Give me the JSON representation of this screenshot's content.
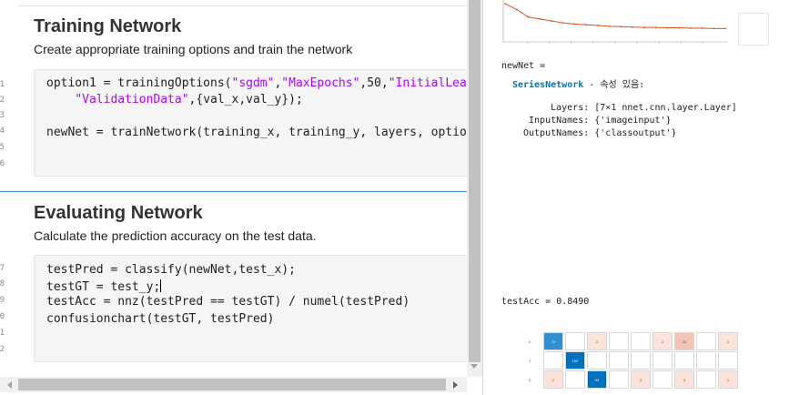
{
  "gutter": {
    "lines": [
      "1",
      "2",
      "3",
      "4",
      "5",
      "6",
      "7",
      "8",
      "9",
      "0",
      "1",
      "2"
    ]
  },
  "training_section": {
    "title": "Training Network",
    "description": "Create appropriate training options and train the network",
    "code": {
      "line1_a": "option1 = trainingOptions(",
      "line1_s1": "\"sgdm\"",
      "line1_b": ",",
      "line1_s2": "\"MaxEpochs\"",
      "line1_c": ",50,",
      "line1_s3": "\"InitialLear",
      "line2_pad": "    ",
      "line2_s1": "\"ValidationData\"",
      "line2_b": ",{val_x,val_y});",
      "line4": "newNet = trainNetwork(training_x, training_y, layers, option"
    }
  },
  "evaluating_section": {
    "title": "Evaluating Network",
    "description": "Calculate the prediction accuracy on the test data.",
    "code": {
      "line1": "testPred = classify(newNet,test_x);",
      "line2": "testGT = test_y;",
      "line3": "testAcc = nnz(testPred == testGT) / numel(testPred)",
      "line4": "confusionchart(testGT, testPred)"
    }
  },
  "output": {
    "newnet_header": "newNet =",
    "newnet_class_link": "SeriesNetwork",
    "newnet_class_suffix": " - 속성 있음:",
    "layers_line": "     Layers: [7×1 nnet.cnn.layer.Layer]",
    "inputnames_line": " InputNames: {'imageinput'}",
    "outputnames_line": "OutputNames: {'classoutput'}",
    "testacc_line": "testAcc = 0.8490"
  },
  "training_plot": {
    "loss_series": [
      0.95,
      0.8,
      0.6,
      0.55,
      0.5,
      0.45,
      0.42,
      0.4,
      0.38,
      0.36,
      0.35,
      0.34,
      0.33,
      0.33,
      0.32,
      0.32,
      0.31,
      0.31,
      0.3,
      0.3
    ],
    "colors": {
      "line": "#d95319",
      "axis": "#9a9a9a"
    }
  },
  "confusion_chart": {
    "row_labels": [
      "0",
      "1",
      "2"
    ],
    "rows": [
      [
        "72",
        "",
        "1",
        "",
        "",
        "1",
        "24",
        "",
        "1"
      ],
      [
        "",
        "100",
        "",
        "",
        "",
        "",
        "",
        "",
        ""
      ],
      [
        "2",
        "",
        "93",
        "",
        "3",
        "",
        "3",
        "",
        "1"
      ]
    ],
    "colors": {
      "diag_strong": "#0072bd",
      "diag_mid": "#2f8fd0",
      "off_light": "#fbe3dc",
      "off_mid": "#f4c4b6"
    }
  },
  "colors": {
    "string": "#a709f5",
    "link": "#0076a8",
    "divider": "#4a9ad6",
    "code_bg": "#f5f5f5"
  }
}
